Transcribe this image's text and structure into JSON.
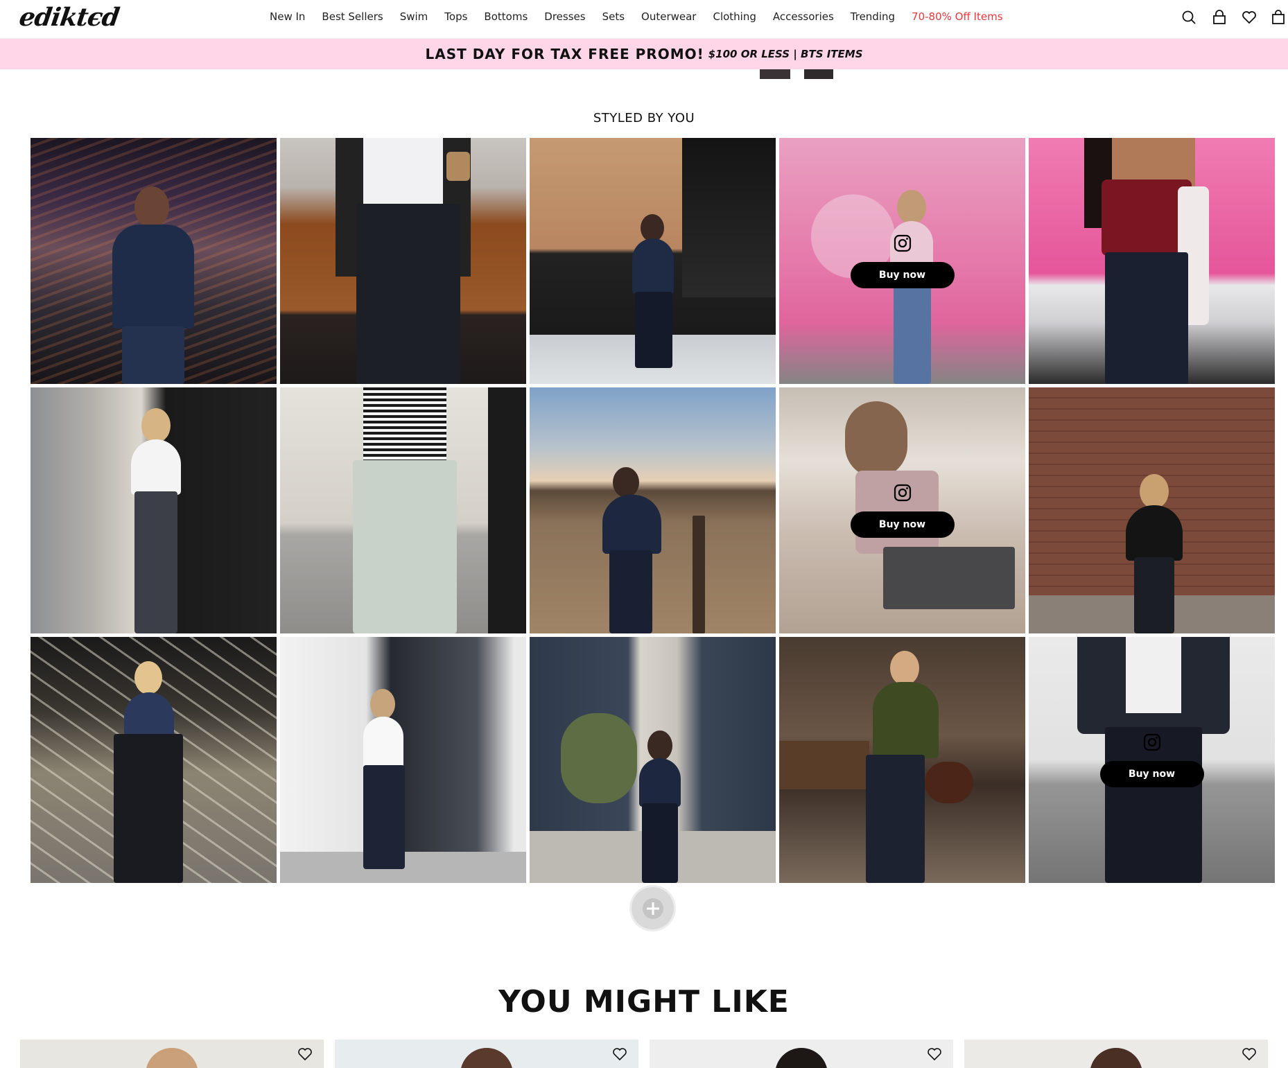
{
  "header": {
    "logo_text": "ediktєd",
    "nav": [
      "New In",
      "Best Sellers",
      "Swim",
      "Tops",
      "Bottoms",
      "Dresses",
      "Sets",
      "Outerwear",
      "Clothing",
      "Accessories",
      "Trending",
      "70-80% Off Items"
    ],
    "sale_color": "#e8383d",
    "icons": [
      "search-icon",
      "account-lock-icon",
      "wishlist-heart-icon",
      "cart-bag-icon"
    ]
  },
  "promo": {
    "main": "LAST DAY FOR TAX FREE PROMO!",
    "sub": "$100 OR LESS | BTS ITEMS",
    "background": "#ffd6e8"
  },
  "styled": {
    "title": "STYLED BY YOU",
    "buy_label": "Buy now",
    "tiles": [
      {
        "name": "ugc-photo-arena-denim-jacket",
        "overlay": false
      },
      {
        "name": "ugc-photo-coffee-low-rise-jeans",
        "overlay": false
      },
      {
        "name": "ugc-photo-brick-wall-denim-set",
        "overlay": false
      },
      {
        "name": "ugc-photo-pink-truck-hey-gorgeous",
        "overlay": true
      },
      {
        "name": "ugc-photo-pink-truck-red-corset",
        "overlay": false
      },
      {
        "name": "ugc-photo-street-white-shirt",
        "overlay": false
      },
      {
        "name": "ugc-photo-striped-top-light-jeans",
        "overlay": false
      },
      {
        "name": "ugc-photo-field-sunset-denim",
        "overlay": false
      },
      {
        "name": "ugc-photo-snakeskin-halter",
        "overlay": true
      },
      {
        "name": "ugc-photo-brick-wall-coffee",
        "overlay": false
      },
      {
        "name": "ugc-photo-stairs-halter-top",
        "overlay": false
      },
      {
        "name": "ugc-photo-saint-laurent-window",
        "overlay": false
      },
      {
        "name": "ugc-photo-hinar-storefront",
        "overlay": false
      },
      {
        "name": "ugc-photo-cafe-green-cardigan",
        "overlay": false
      },
      {
        "name": "ugc-photo-denim-jacket-closeup",
        "overlay": true
      }
    ]
  },
  "you_might_like": {
    "title": "YOU MIGHT LIKE",
    "product_count_visible": 4
  }
}
